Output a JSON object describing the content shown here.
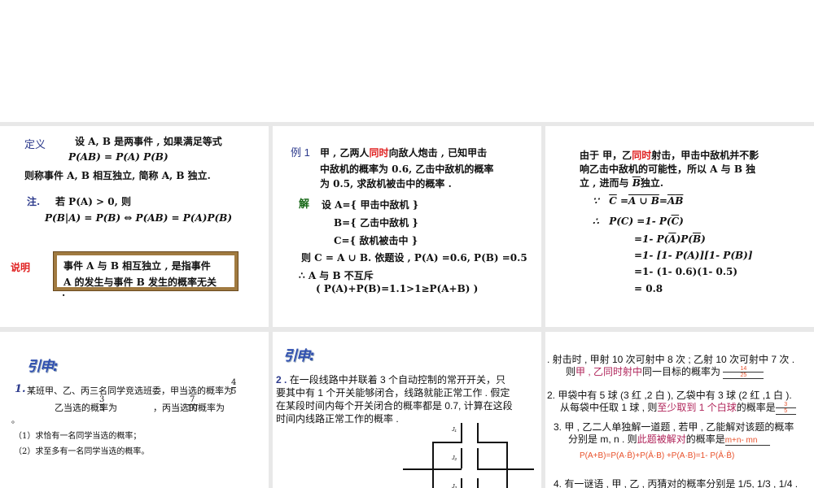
{
  "slide1": {
    "def_label": "定义",
    "def_line1": "设 A, B 是两事件 , 如果满足等式",
    "def_eq": "P(AB) = P(A) P(B)",
    "def_line3": "则称事件 A, B 相互独立, 简称 A, B 独立.",
    "note_label": "注.",
    "note_line1": "若 P(A) > 0, 则",
    "note_eq": "P(B|A) = P(B) ⇔  P(AB) = P(A)P(B)",
    "explain_label": "说明",
    "box_line1": "事件  A  与  B  相互独立 , 是指事件",
    "box_line2": "A  的发生与事件  B  发生的概率无关",
    "dot": "."
  },
  "slide2": {
    "ex_label": "例 1",
    "l1a": "甲 , 乙两人",
    "l1red": "同时",
    "l1b": "向敌人炮击 , 已知甲击",
    "l2": "中敌机的概率为 0.6,  乙击中敌机的概率",
    "l3": "为 0.5,  求敌机被击中的概率 .",
    "sol_label": "解",
    "s1": "设  A={  甲击中敌机   }",
    "s2": "B={  乙击中敌机   }",
    "s3": "C={ 敌机被击中   }",
    "s4": "则    C = A ∪ B.   依题设 , P(A) =0.6,    P(B) =0.5",
    "s5": "∴ A 与 B 不互斥",
    "s6": "(  P(A)+P(B)=1.1>1≥P(A+B)  )"
  },
  "slide3": {
    "l1a": "由于  甲，乙",
    "l1red": "同时",
    "l1b": "射击，甲击中敌机并不影",
    "l2": "响乙击中敌机的可能性，所以   A 与 B 独",
    "l3a": "立 , 进而",
    "l3b": "与 ",
    "l3c": "B",
    "l3d": "独立.",
    "because": "∵",
    "eq1a": "C",
    "eq1b": "=",
    "eq1c": "A ∪ B",
    "eq1d": "=",
    "eq1e": "A",
    "eq1f": "B",
    "therefore": "∴",
    "eq2": "P(C) =1-  P(",
    "eq2c": "C",
    "eq2e": ")",
    "eq3a": "=1-  P(",
    "eq3b": "A",
    "eq3c": ")P(",
    "eq3d": "B",
    "eq3e": ")",
    "eq4": "=1-  [1-  P(A)][1-  P(B)]",
    "eq5": "=1-  (1-  0.6)(1-  0.5)",
    "eq6": "= 0.8"
  },
  "slide4": {
    "title": "引申:",
    "num": "1.",
    "l1": "某班甲、乙、丙三名同学竞选班委，甲当选的概率为",
    "f1n": "4",
    "f1d": "5",
    "l2a": "乙当选的概率为",
    "f2n": "3",
    "f2d": "5",
    "l2b": "，丙当选的概率为",
    "f3n": "7",
    "f3d": "10",
    "end": "。",
    "q1": "（1）求恰有一名同学当选的概率；",
    "q2": "（2）求至多有一名同学当选的概率。"
  },
  "slide5": {
    "title": "引申:",
    "num": "2 .",
    "l1": "在一段线路中并联着 3 个自动控制的常开开关，只",
    "l2": "要其中有 1 个开关能够闭合，线路就能正常工作 . 假定",
    "l3": "在某段时间内每个开关闭合的概率都是 0.7, 计算在这段",
    "l4": "时间内线路正常工作的概率 .",
    "j1": "J₁",
    "j2": "J₂",
    "j3": "J₃"
  },
  "slide6": {
    "p1a": ". 射击时 , 甲射 10 次可射中 8 次 ; 乙射 10 次可射中 7 次 .",
    "p1b": "则",
    "p1c": "甲 , 乙同时射中",
    "p1d": "同一目标的概率为",
    "a1n": "14",
    "a1d": "25",
    "p2a": "2. 甲袋中有 5 球  (3 红 ,2 白 ),  乙袋中有 3 球  (2 红 ,1 白 ).",
    "p2b": "从每袋中任取 1 球 , 则",
    "p2c": "至少取到 1 个白球",
    "p2d": "的概率是",
    "a2n": "3",
    "a2d": "5",
    "p3a": "3. 甲 , 乙二人单独解一道题 , 若甲 , 乙能解对该题的概率",
    "p3b": "分别是 m, n . 则",
    "p3c": "此题被解对",
    "p3d": "的概率是",
    "a3": "m+n- mn",
    "formula": "P(A+B)=P(A·B̄)+P(Ā·B) +P(A·B)=1- P(Ā·B̄)",
    "p4": "4. 有一谜语 , 甲 , 乙 , 丙猜对的概率分别是 1/5, 1/3 , 1/4 ."
  },
  "colors": {
    "blue": "#2c3a8c",
    "red": "#e02020",
    "mag": "#b0245a",
    "orange": "#e8502a"
  }
}
